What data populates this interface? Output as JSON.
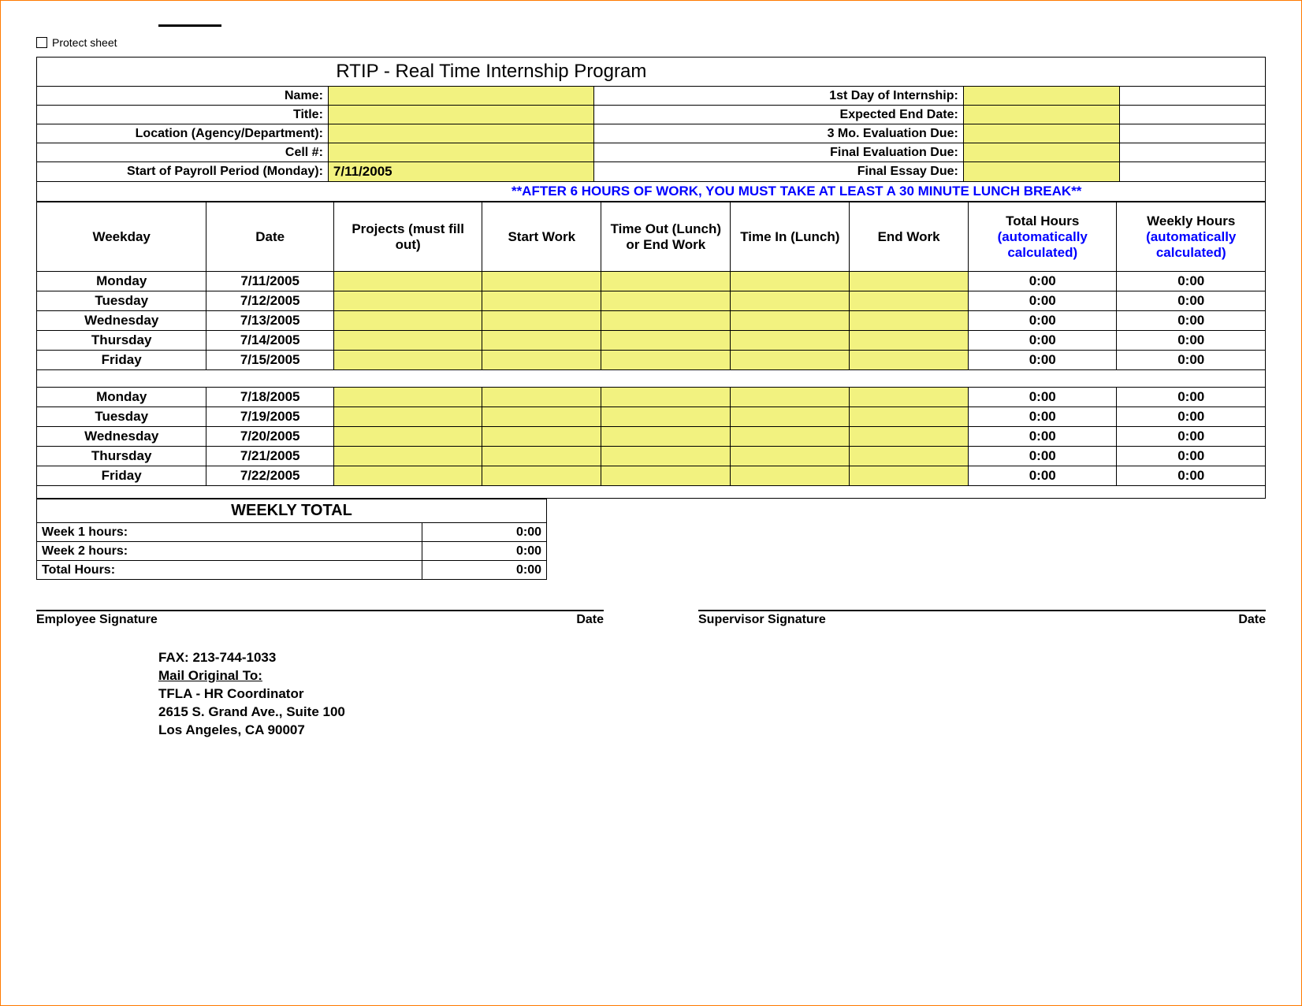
{
  "protect_label": "Protect sheet",
  "title": "RTIP - Real Time Internship Program",
  "info": {
    "name_label": "Name:",
    "title_label": "Title:",
    "location_label": "Location (Agency/Department):",
    "cell_label": "Cell #:",
    "payroll_label": "Start of Payroll Period (Monday):",
    "payroll_value": "7/11/2005",
    "first_day_label": "1st Day of Internship:",
    "expected_end_label": "Expected End Date:",
    "eval3_label": "3 Mo. Evaluation Due:",
    "final_eval_label": "Final Evaluation Due:",
    "final_essay_label": "Final Essay Due:"
  },
  "notice": "**AFTER 6 HOURS OF WORK, YOU MUST TAKE AT LEAST A 30 MINUTE LUNCH BREAK**",
  "columns": {
    "weekday": "Weekday",
    "date": "Date",
    "projects": "Projects (must fill out)",
    "start": "Start Work",
    "out": "Time Out (Lunch) or End Work",
    "in": "Time In (Lunch)",
    "end": "End Work",
    "total_a": "Total Hours",
    "total_b": "(automatically calculated)",
    "weekly_a": "Weekly Hours",
    "weekly_b": "(automatically calculated)"
  },
  "rows": [
    {
      "day": "Monday",
      "date": "7/11/2005",
      "total": "0:00",
      "weekly": "0:00"
    },
    {
      "day": "Tuesday",
      "date": "7/12/2005",
      "total": "0:00",
      "weekly": "0:00"
    },
    {
      "day": "Wednesday",
      "date": "7/13/2005",
      "total": "0:00",
      "weekly": "0:00"
    },
    {
      "day": "Thursday",
      "date": "7/14/2005",
      "total": "0:00",
      "weekly": "0:00"
    },
    {
      "day": "Friday",
      "date": "7/15/2005",
      "total": "0:00",
      "weekly": "0:00"
    },
    {
      "day": "Monday",
      "date": "7/18/2005",
      "total": "0:00",
      "weekly": "0:00"
    },
    {
      "day": "Tuesday",
      "date": "7/19/2005",
      "total": "0:00",
      "weekly": "0:00"
    },
    {
      "day": "Wednesday",
      "date": "7/20/2005",
      "total": "0:00",
      "weekly": "0:00"
    },
    {
      "day": "Thursday",
      "date": "7/21/2005",
      "total": "0:00",
      "weekly": "0:00"
    },
    {
      "day": "Friday",
      "date": "7/22/2005",
      "total": "0:00",
      "weekly": "0:00"
    }
  ],
  "weekly_total": {
    "header": "WEEKLY TOTAL",
    "w1_label": "Week 1 hours:",
    "w1": "0:00",
    "w2_label": "Week 2 hours:",
    "w2": "0:00",
    "total_label": "Total Hours:",
    "total": "0:00"
  },
  "sig": {
    "emp": "Employee Signature",
    "sup": "Supervisor Signature",
    "date": "Date"
  },
  "footer": {
    "fax": "FAX:  213-744-1033",
    "mail": "Mail Original To:",
    "l1": "TFLA - HR Coordinator",
    "l2": "2615 S. Grand Ave., Suite 100",
    "l3": "Los Angeles, CA 90007"
  }
}
